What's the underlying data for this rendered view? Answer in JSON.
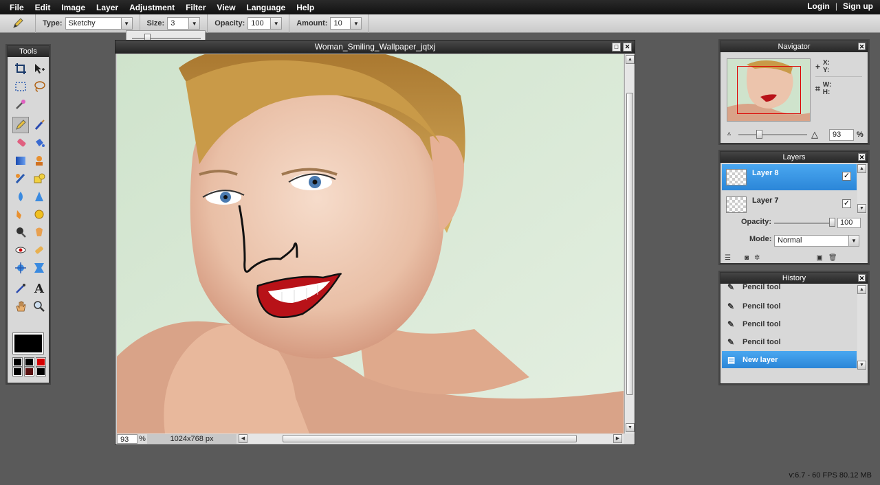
{
  "menu": {
    "items": [
      "File",
      "Edit",
      "Image",
      "Layer",
      "Adjustment",
      "Filter",
      "View",
      "Language",
      "Help"
    ],
    "login": "Login",
    "separator": "|",
    "signup": "Sign up"
  },
  "options": {
    "type_label": "Type:",
    "type_value": "Sketchy",
    "size_label": "Size:",
    "size_value": "3",
    "opacity_label": "Opacity:",
    "opacity_value": "100",
    "amount_label": "Amount:",
    "amount_value": "10",
    "arrow": "▼"
  },
  "tools": {
    "title": "Tools",
    "foreground_color": "#000000",
    "swatches": [
      "#000000",
      "#000000",
      "#d40000",
      "#000000",
      "#5a1010",
      "#000000"
    ]
  },
  "image_window": {
    "title": "Woman_Smiling_Wallpaper_jqtxj",
    "zoom": "93",
    "zoom_unit": "%",
    "dimensions": "1024x768 px",
    "restore_btn": "□",
    "close_btn": "✕"
  },
  "navigator": {
    "title": "Navigator",
    "close": "✕",
    "x_label": "X:",
    "y_label": "Y:",
    "w_label": "W:",
    "h_label": "H:",
    "zoom": "93",
    "zoom_unit": "%"
  },
  "layers": {
    "title": "Layers",
    "close": "✕",
    "items": [
      {
        "name": "Layer 8",
        "selected": true,
        "visible": "✓"
      },
      {
        "name": "Layer 7",
        "selected": false,
        "visible": "✓"
      }
    ],
    "opacity_label": "Opacity:",
    "opacity_value": "100",
    "mode_label": "Mode:",
    "mode_value": "Normal"
  },
  "history": {
    "title": "History",
    "close": "✕",
    "items": [
      "Pencil tool",
      "Pencil tool",
      "Pencil tool",
      "Pencil tool",
      "New layer"
    ]
  },
  "status": {
    "version": "v:6.7 - 60 FPS 80.12 MB"
  },
  "colors": {
    "selection": "#2b86d8",
    "lips": "#b81218"
  }
}
